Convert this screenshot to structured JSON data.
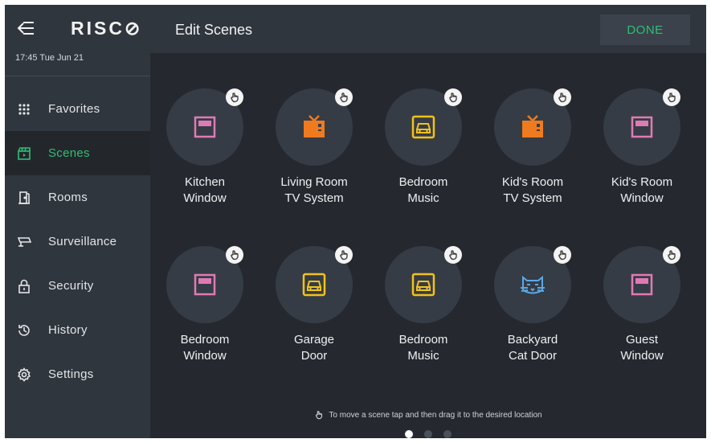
{
  "sidebar": {
    "logo": "RISC",
    "logo_mark": "⊘",
    "clock": "17:45  Tue Jun 21",
    "items": [
      {
        "label": "Favorites",
        "icon": "grid-icon"
      },
      {
        "label": "Scenes",
        "icon": "clapperboard-icon"
      },
      {
        "label": "Rooms",
        "icon": "door-icon"
      },
      {
        "label": "Surveillance",
        "icon": "camera-icon"
      },
      {
        "label": "Security",
        "icon": "lock-icon"
      },
      {
        "label": "History",
        "icon": "history-icon"
      },
      {
        "label": "Settings",
        "icon": "gear-icon"
      }
    ],
    "active_index": 1
  },
  "header": {
    "title": "Edit Scenes",
    "done_label": "DONE"
  },
  "scenes": [
    {
      "line1": "Kitchen",
      "line2": "Window",
      "icon": "window-icon"
    },
    {
      "line1": "Living Room",
      "line2": "TV System",
      "icon": "tv-icon"
    },
    {
      "line1": "Bedroom",
      "line2": "Music",
      "icon": "garage-icon"
    },
    {
      "line1": "Kid's Room",
      "line2": "TV System",
      "icon": "tv-icon"
    },
    {
      "line1": "Kid's Room",
      "line2": "Window",
      "icon": "window-icon"
    },
    {
      "line1": "Bedroom",
      "line2": "Window",
      "icon": "window-icon"
    },
    {
      "line1": "Garage",
      "line2": "Door",
      "icon": "garage-icon"
    },
    {
      "line1": "Bedroom",
      "line2": "Music",
      "icon": "garage-icon"
    },
    {
      "line1": "Backyard",
      "line2": "Cat Door",
      "icon": "cat-icon"
    },
    {
      "line1": "Guest",
      "line2": "Window",
      "icon": "window-icon"
    }
  ],
  "footer": {
    "hint": "To move a scene tap and then drag it to the desired location",
    "page_count": 3,
    "current_page": 1
  },
  "colors": {
    "accent_green": "#2fbf74",
    "window_pink": "#e07ab5",
    "tv_orange": "#f07a1e",
    "garage_yellow": "#f2c21b",
    "cat_blue": "#5aa9e6"
  }
}
